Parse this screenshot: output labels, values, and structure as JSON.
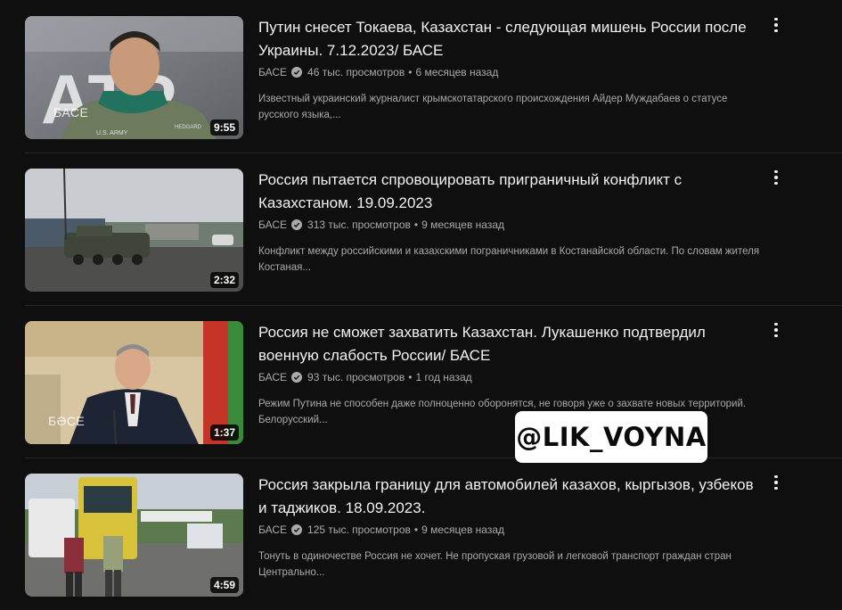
{
  "videos": [
    {
      "title": "Путин снесет Токаева, Казахстан - следующая мишень России после Украины. 7.12.2023/ БАСЕ",
      "channel": "БАСЕ",
      "views": "46 тыс. просмотров",
      "age": "6 месяцев назад",
      "description": "Известный украинский журналист крымскотатарского происхождения Айдер Муждабаев о статусе русского языка,...",
      "duration": "9:55",
      "thumb_watermark": "БАСЕ",
      "thumb_sign": "АТР",
      "thumb_patch_1": "U.S. ARMY",
      "thumb_patch_2": "HEDGARD"
    },
    {
      "title": "Россия пытается спровоцировать приграничный конфликт с Казахстаном. 19.09.2023",
      "channel": "БАСЕ",
      "views": "313 тыс. просмотров",
      "age": "9 месяцев назад",
      "description": "Конфликт между российскими и казахскими пограничниками в Костанайской области. По словам жителя Костаная...",
      "duration": "2:32"
    },
    {
      "title": "Россия не сможет захватить Казахстан. Лукашенко подтвердил военную слабость России/ БАСЕ",
      "channel": "БАСЕ",
      "views": "93 тыс. просмотров",
      "age": "1 год назад",
      "description": "Режим Путина не способен даже полноценно оборонятся, не говоря уже о захвате новых территорий. Белорусский...",
      "duration": "1:37",
      "thumb_watermark": "БӘСЕ"
    },
    {
      "title": "Россия закрыла границу для автомобилей казахов, кыргызов, узбеков и таджиков. 18.09.2023.",
      "channel": "БАСЕ",
      "views": "125 тыс. просмотров",
      "age": "9 месяцев назад",
      "description": "Тонуть в одиночестве Россия не хочет. Не пропуская грузовой и легковой транспорт граждан стран Центрально...",
      "duration": "4:59"
    }
  ],
  "separator": "•",
  "overlay": {
    "text": "@LIK_VOYNA"
  },
  "colors": {
    "background": "#0f0f0f",
    "title": "#f1f1f1",
    "meta": "#aaaaaa"
  },
  "icons": {
    "verified": "verified-check-icon",
    "menu": "more-vert-icon"
  }
}
